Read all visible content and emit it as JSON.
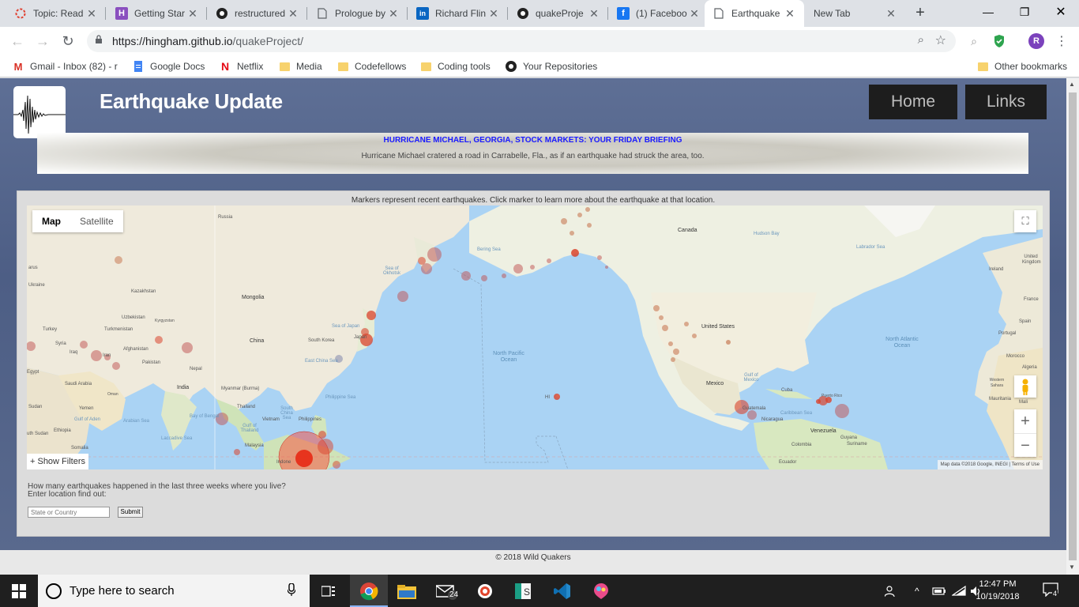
{
  "browser": {
    "tabs": [
      {
        "title": "Topic: Read",
        "icon": "loading-spinner-icon",
        "color": "#e04030"
      },
      {
        "title": "Getting Star",
        "icon": "h-logo-icon",
        "color": "#8a4fbf"
      },
      {
        "title": "restructured",
        "icon": "github-icon",
        "color": "#222"
      },
      {
        "title": "Prologue by",
        "icon": "document-icon",
        "color": "#5f6368"
      },
      {
        "title": "Richard Flin",
        "icon": "linkedin-icon",
        "color": "#0a66c2"
      },
      {
        "title": "quakeProje",
        "icon": "github-icon",
        "color": "#222"
      },
      {
        "title": "(1) Faceboo",
        "icon": "facebook-icon",
        "color": "#1877f2"
      },
      {
        "title": "Earthquake",
        "icon": "document-icon",
        "color": "#5f6368"
      },
      {
        "title": "New Tab",
        "icon": "",
        "color": "#5f6368"
      }
    ],
    "active_tab": 7,
    "url_host": "https://hingham.github.io",
    "url_path": "/quakeProject/",
    "profile_initial": "R"
  },
  "bookmarks": [
    {
      "label": "Gmail - Inbox (82) - r",
      "icon": "gmail-icon"
    },
    {
      "label": "Google Docs",
      "icon": "google-docs-icon"
    },
    {
      "label": "Netflix",
      "icon": "netflix-icon"
    },
    {
      "label": "Media",
      "icon": "folder-icon"
    },
    {
      "label": "Codefellows",
      "icon": "folder-icon"
    },
    {
      "label": "Coding tools",
      "icon": "folder-icon"
    },
    {
      "label": "Your Repositories",
      "icon": "github-icon"
    },
    {
      "label": "Other bookmarks",
      "icon": "folder-icon"
    }
  ],
  "site": {
    "title": "Earthquake Update",
    "nav": [
      "Home",
      "Links"
    ],
    "news": {
      "headline": "HURRICANE MICHAEL, GEORGIA, STOCK MARKETS: YOUR FRIDAY BRIEFING",
      "summary": "Hurricane Michael cratered a road in Carrabelle, Fla., as if an earthquake had struck the area, too."
    },
    "map_caption": "Markers represent recent earthquakes. Click marker to learn more about the earthquake at that location.",
    "map": {
      "type_buttons": [
        "Map",
        "Satellite"
      ],
      "selected_type": "Map",
      "show_filters": "+ Show Filters",
      "attribution": "Map data ©2018 Google, INEGI",
      "terms": "Terms of Use",
      "labels": {
        "russia": "Russia",
        "kazakhstan": "Kazakhstan",
        "mongolia": "Mongolia",
        "china": "China",
        "india": "India",
        "ukraine": "Ukraine",
        "turkey": "Turkey",
        "uzbekistan": "Uzbekistan",
        "kyrgyzstan": "Kyrgyzstan",
        "turkmenistan": "Turkmenistan",
        "afghanistan": "Afghanistan",
        "pakistan": "Pakistan",
        "iran": "Iran",
        "iraq": "Iraq",
        "syria": "Syria",
        "egypt": "Egypt",
        "saudi_arabia": "Saudi Arabia",
        "oman": "Oman",
        "yemen": "Yemen",
        "sudan": "Sudan",
        "ethiopia": "Ethiopia",
        "south_sudan": "uth Sudan",
        "somalia": "Somalia",
        "nepal": "Nepal",
        "myanmar": "Myanmar (Burma)",
        "thailand": "Thailand",
        "vietnam": "Vietnam",
        "philippines": "Philippines",
        "malaysia": "Malaysia",
        "south_korea": "South Korea",
        "japan": "Japan",
        "canada": "Canada",
        "united_states": "United States",
        "mexico": "Mexico",
        "cuba": "Cuba",
        "guatemala": "Guatemala",
        "nicaragua": "Nicaragua",
        "venezuela": "Venezuela",
        "colombia": "Colombia",
        "guyana": "Guyana",
        "suriname": "Suriname",
        "ecuador": "Ecuador",
        "ireland": "Ireland",
        "united_kingdom": "United Kingdom",
        "france": "France",
        "spain": "Spain",
        "portugal": "Portugal",
        "morocco": "Morocco",
        "algeria": "Algeria",
        "western_sahara": "Western Sahara",
        "mauritania": "Mauritania",
        "mali": "Mali",
        "north_pacific": "North Pacific Ocean",
        "north_atlantic": "North Atlantic Ocean",
        "bering_sea": "Bering Sea",
        "sea_of_okhotsk": "Sea of Okhotsk",
        "sea_of_japan": "Sea of Japan",
        "east_china_sea": "East China Sea",
        "philippine_sea": "Philippine Sea",
        "south_china_sea": "South China Sea",
        "gulf_of_thailand": "Gulf of Thailand",
        "bay_of_bengal": "Bay of Bengal",
        "arabian_sea": "Arabian Sea",
        "laccadive_sea": "Laccadive Sea",
        "gulf_of_aden": "Gulf of Aden",
        "hudson_bay": "Hudson Bay",
        "labrador_sea": "Labrador Sea",
        "gulf_of_mexico": "Gulf of Mexico",
        "caribbean_sea": "Caribbean Sea",
        "puerto_rico": "Puerto Rico",
        "indonesia": "Indone",
        "arus": "arus",
        "hi": "HI"
      }
    },
    "form": {
      "question": "How many earthquakes happened in the last three weeks where you live?",
      "instruction": "Enter location find out:",
      "placeholder": "State or Country",
      "submit": "Submit"
    },
    "footer": "© 2018 Wild Quakers"
  },
  "taskbar": {
    "search_placeholder": "Type here to search",
    "time": "12:47 PM",
    "date": "10/19/2018",
    "mail_badge": "24",
    "notification_count": "4"
  }
}
